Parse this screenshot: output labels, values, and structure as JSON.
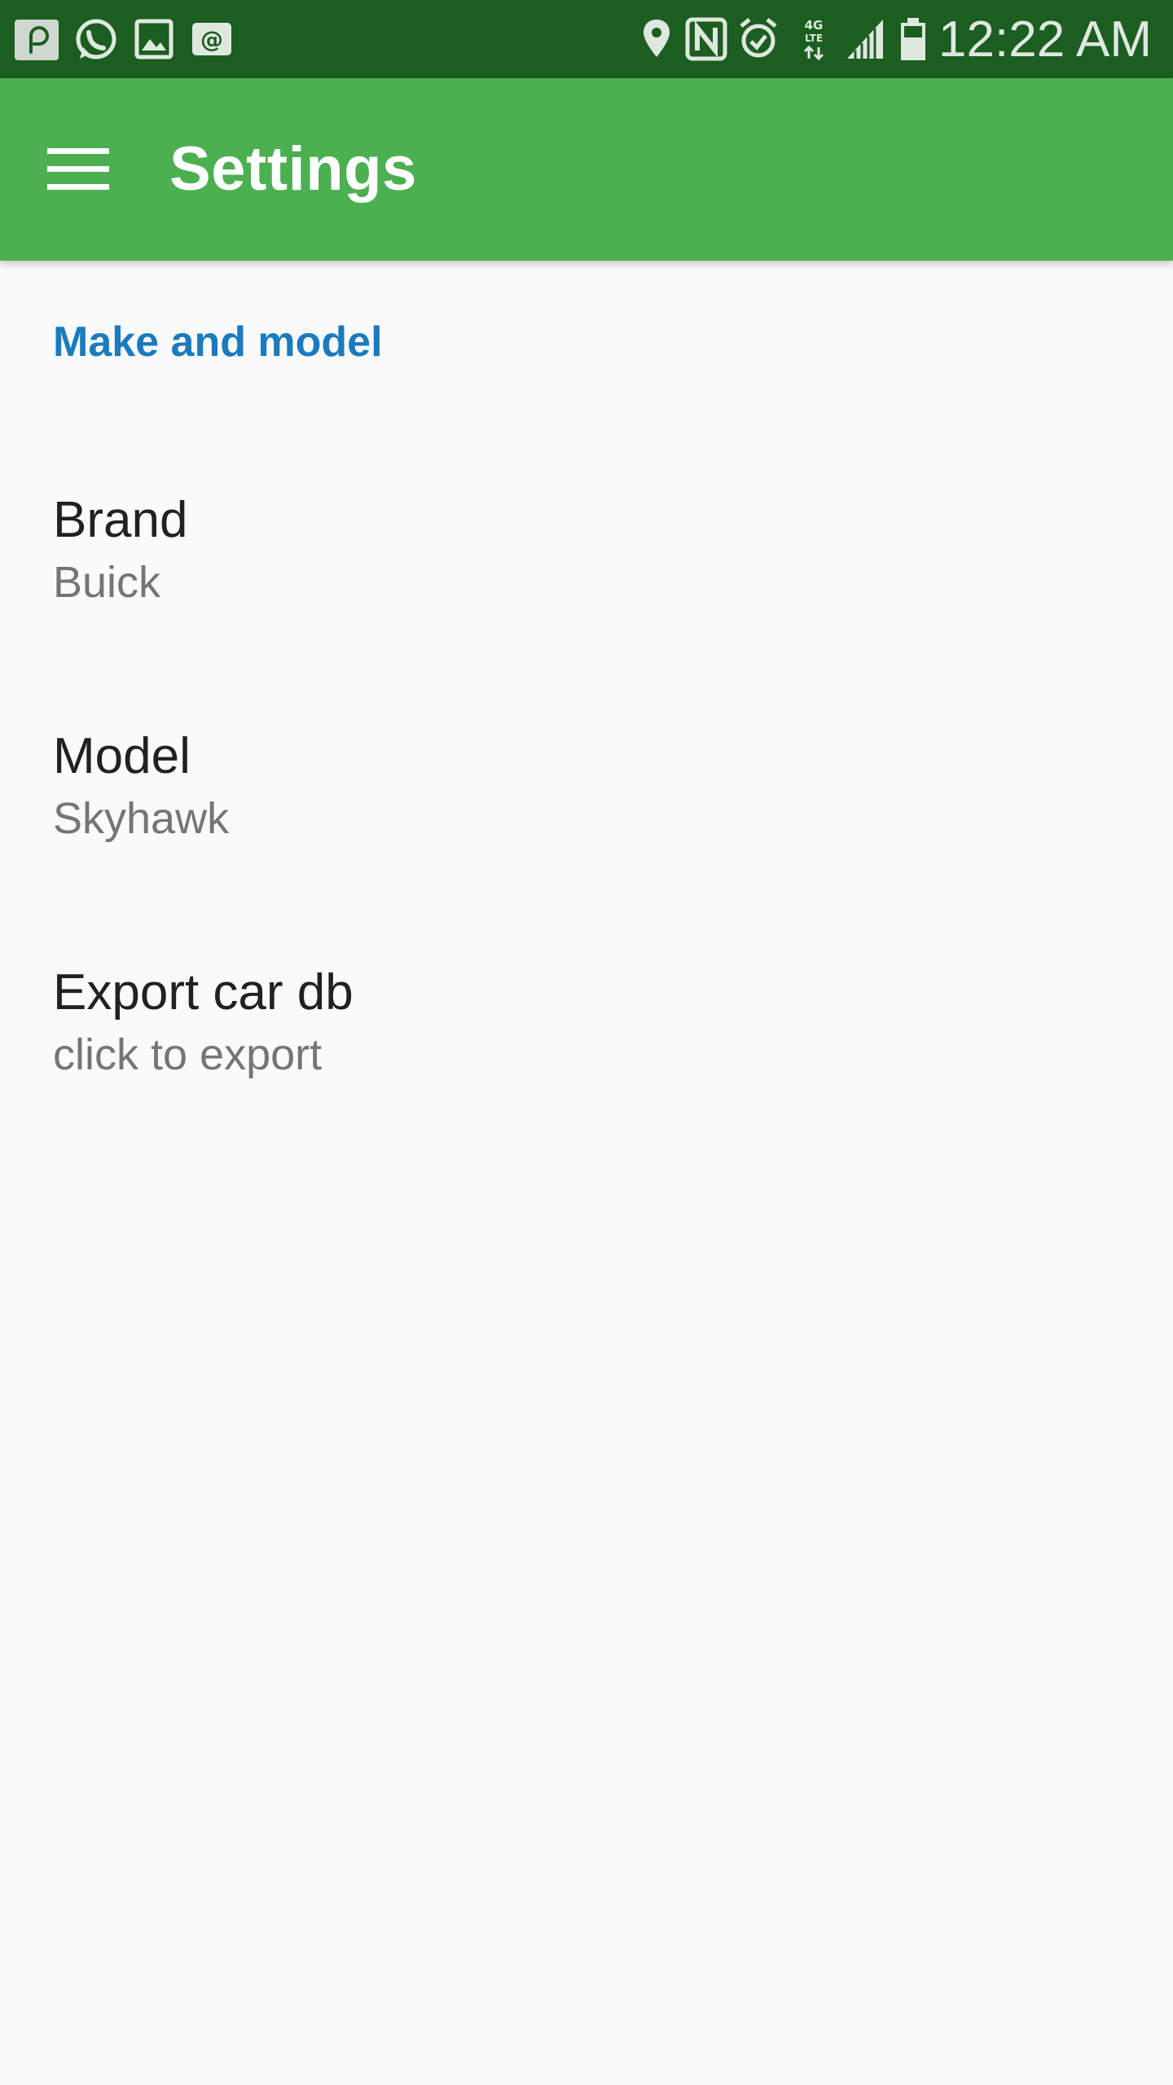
{
  "status_bar": {
    "time": "12:22 AM",
    "network": "4G LTE",
    "left_icons": [
      "pocket-casts-icon",
      "whatsapp-icon",
      "gallery-icon",
      "email-icon"
    ],
    "right_icons": [
      "location-icon",
      "nfc-icon",
      "alarm-icon",
      "network-4g-lte-icon",
      "signal-icon",
      "battery-icon"
    ]
  },
  "app_bar": {
    "title": "Settings",
    "menu_icon": "menu-icon",
    "color": "#4caf50",
    "status_color": "#1b5e20"
  },
  "preferences": {
    "category_title": "Make and model",
    "category_color": "#1a7bbf",
    "items": [
      {
        "title": "Brand",
        "summary": "Buick"
      },
      {
        "title": "Model",
        "summary": "Skyhawk"
      },
      {
        "title": "Export car db",
        "summary": "click to export"
      }
    ]
  }
}
